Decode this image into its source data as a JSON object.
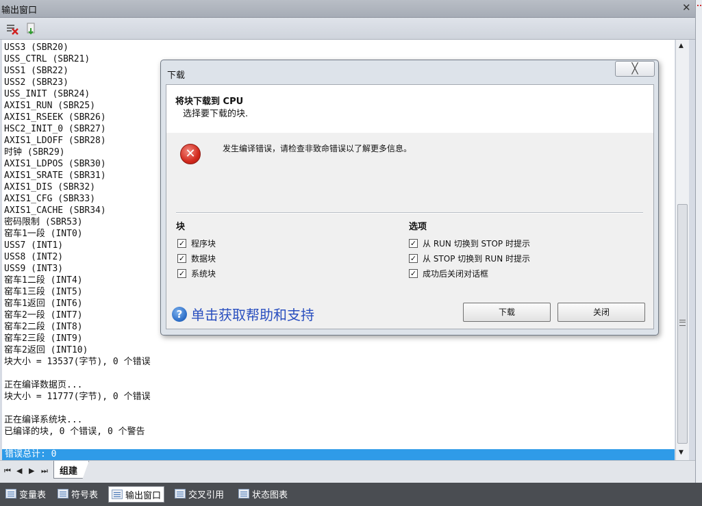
{
  "window": {
    "title": "输出窗口",
    "close_label": "✕"
  },
  "toolbar": {
    "icons": [
      "clear-icon",
      "copy-icon"
    ]
  },
  "log": {
    "lines": [
      "USS3 (SBR20)",
      "USS_CTRL (SBR21)",
      "USS1 (SBR22)",
      "USS2 (SBR23)",
      "USS_INIT (SBR24)",
      "AXIS1_RUN (SBR25)",
      "AXIS1_RSEEK (SBR26)",
      "HSC2_INIT_0 (SBR27)",
      "AXIS1_LDOFF (SBR28)",
      "时钟 (SBR29)",
      "AXIS1_LDPOS (SBR30)",
      "AXIS1_SRATE (SBR31)",
      "AXIS1_DIS (SBR32)",
      "AXIS1_CFG (SBR33)",
      "AXIS1_CACHE (SBR34)",
      "密码限制 (SBR53)",
      "窑车1一段 (INT0)",
      "USS7 (INT1)",
      "USS8 (INT2)",
      "USS9 (INT3)",
      "窑车1二段 (INT4)",
      "窑车1三段 (INT5)",
      "窑车1返回 (INT6)",
      "窑车2一段 (INT7)",
      "窑车2二段 (INT8)",
      "窑车2三段 (INT9)",
      "窑车2返回 (INT10)",
      "块大小 = 13537(字节), 0 个错误",
      "",
      "正在编译数据页...",
      "块大小 = 11777(字节), 0 个错误",
      "",
      "正在编译系统块...",
      "已编译的块, 0 个错误, 0 个警告"
    ],
    "error_total": "错误总计: 0"
  },
  "tabs": {
    "nav": [
      "⏮",
      "◀",
      "▶",
      "⏭"
    ],
    "active": "组建"
  },
  "bottombar": {
    "items": [
      "变量表",
      "符号表",
      "输出窗口",
      "交叉引用",
      "状态图表"
    ],
    "active_index": 2
  },
  "dialog": {
    "title": "下载",
    "close_label": "╳",
    "heading": "将块下载到 CPU",
    "subheading": "选择要下载的块.",
    "error_message": "发生编译错误，请检查非致命错误以了解更多信息。",
    "blocks_title": "块",
    "blocks": [
      {
        "label": "程序块",
        "checked": true
      },
      {
        "label": "数据块",
        "checked": true
      },
      {
        "label": "系统块",
        "checked": true
      }
    ],
    "options_title": "选项",
    "options": [
      {
        "label": "从 RUN 切换到 STOP 时提示",
        "checked": true
      },
      {
        "label": "从 STOP 切换到 RUN 时提示",
        "checked": true
      },
      {
        "label": "成功后关闭对话框",
        "checked": true
      }
    ],
    "help_text": "单击获取帮助和支持",
    "download_button": "下载",
    "close_button": "关闭"
  },
  "colors": {
    "error_bar": "#2f9be8",
    "help_link": "#2a4fbf",
    "bottom_bar": "#4a4d52"
  }
}
